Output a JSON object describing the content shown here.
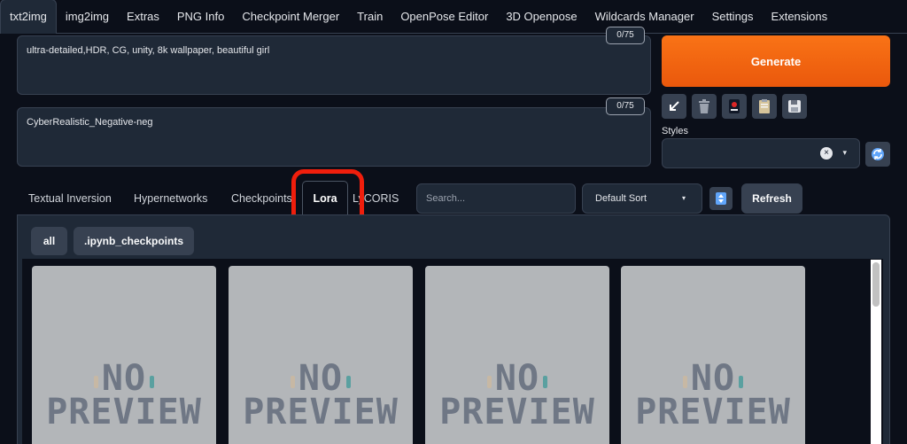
{
  "top_tabs": [
    "txt2img",
    "img2img",
    "Extras",
    "PNG Info",
    "Checkpoint Merger",
    "Train",
    "OpenPose Editor",
    "3D Openpose",
    "Wildcards Manager",
    "Settings",
    "Extensions"
  ],
  "prompt": {
    "value": "ultra-detailed,HDR, CG, unity, 8k wallpaper, beautiful girl",
    "token_count": "0/75"
  },
  "negative_prompt": {
    "value": "CyberRealistic_Negative-neg",
    "token_count": "0/75"
  },
  "generate_label": "Generate",
  "tool_icons": [
    "arrow-icon",
    "trash-icon",
    "red-card-icon",
    "clipboard-icon",
    "save-icon"
  ],
  "styles": {
    "label": "Styles",
    "clear": "×",
    "caret": "▾"
  },
  "extra_networks": {
    "tabs": [
      "Textual Inversion",
      "Hypernetworks",
      "Checkpoints",
      "Lora",
      "LyCORIS"
    ],
    "active_tab": "Lora",
    "search_placeholder": "Search...",
    "sort_value": "Default Sort",
    "sort_caret": "▾",
    "refresh_label": "Refresh",
    "filters": [
      "all",
      ".ipynb_checkpoints"
    ],
    "card_text": [
      "NO",
      "PREVIEW"
    ]
  },
  "colors": {
    "accent": "#f97316",
    "highlight": "#f01e0c",
    "background": "#0b0f19"
  }
}
